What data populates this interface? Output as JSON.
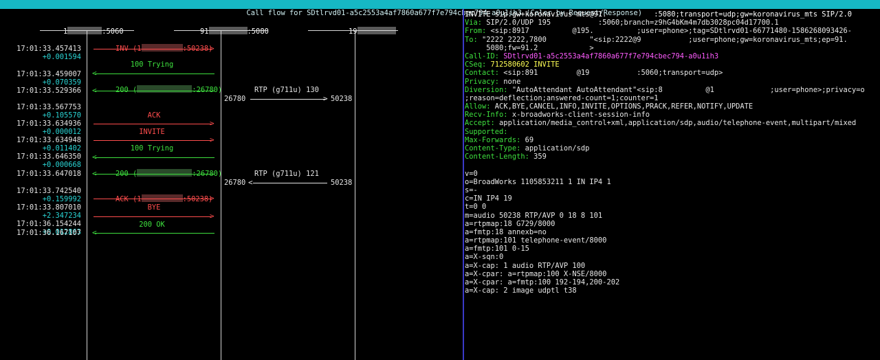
{
  "title": "Call flow for SDtlrvd01-a5c2553a4af7860a677f7e794cbec794-a0u1ih3 (Color by Request/Response)",
  "hosts": [
    {
      "label_left": "1",
      "label_right": ":5060"
    },
    {
      "label_left": "91",
      "label_right": ":5080"
    },
    {
      "label_left": "19",
      "label_right": ""
    }
  ],
  "flow": [
    {
      "ts": "17:01:33.457413",
      "delta": "+0.001594",
      "label_left": "INV (1",
      "label_right": ":50238)",
      "kind": "req",
      "dir": "right"
    },
    {
      "ts": "17:01:33.459007",
      "delta": "+0.070359",
      "label_left": "100 Trying",
      "label_right": "",
      "kind": "rsp",
      "dir": "left"
    },
    {
      "ts": "17:01:33.529366",
      "delta": "",
      "label_left": "200 (",
      "label_right": ":26780)",
      "kind": "rsp",
      "dir": "left"
    },
    {
      "ts": "17:01:33.567753",
      "delta": "+0.105570",
      "label_left": "ACK",
      "label_right": "",
      "kind": "req",
      "dir": "right"
    },
    {
      "ts": "17:01:33.634936",
      "delta": "+0.000012",
      "label_left": "INVITE",
      "label_right": "",
      "kind": "req",
      "dir": "right"
    },
    {
      "ts": "17:01:33.634948",
      "delta": "+0.011402",
      "label_left": "100 Trying",
      "label_right": "",
      "kind": "rsp",
      "dir": "left"
    },
    {
      "ts": "17:01:33.646350",
      "delta": "+0.000668",
      "label_left": "200 (",
      "label_right": ":26780)",
      "kind": "rsp",
      "dir": "left"
    },
    {
      "ts": "17:01:33.647018",
      "delta": "",
      "label_left": "",
      "label_right": "",
      "kind": "none",
      "dir": "none"
    },
    {
      "ts": "17:01:33.742540",
      "delta": "+0.159992",
      "label_left": "ACK (1",
      "label_right": ":50238)",
      "kind": "req",
      "dir": "right"
    },
    {
      "ts": "17:01:33.807010",
      "delta": "+2.347234",
      "label_left": "BYE",
      "label_right": "",
      "kind": "req",
      "dir": "right"
    },
    {
      "ts": "17:01:36.154244",
      "delta": "+0.012863",
      "label_left": "200 OK",
      "label_right": "",
      "kind": "rsp",
      "dir": "left"
    },
    {
      "ts": "17:01:36.167107",
      "delta": "",
      "label_left": "",
      "label_right": "",
      "kind": "none",
      "dir": "none"
    }
  ],
  "rtp": [
    {
      "label": "RTP (g711u) 130",
      "left_port": "26780",
      "right_port": "50238",
      "dir": "right"
    },
    {
      "label": "RTP (g711u) 121",
      "left_port": "26780",
      "right_port": "50238",
      "dir": "left"
    }
  ],
  "detail": {
    "first_line": "INVITE sip:gw+koronavirus mts@91.           :5080;transport=udp;gw=koronavirus_mts SIP/2.0",
    "headers": [
      {
        "k": "Via:",
        "v": " SIP/2.0/UDP 195           :5060;branch=z9hG4bKm4m7db3028pc04d17700.1",
        "c": "hv"
      },
      {
        "k": "From:",
        "v": " <sip:8917          @195.          ;user=phone>;tag=SDtlrvd01-66771480-1586268093426-",
        "c": "hv"
      },
      {
        "k": "To:",
        "v": " \"2222 2222,7800          \"<sip:2222@9           ;user=phone;gw=koronavirus_mts;ep=91.",
        "c": "hv"
      },
      {
        "k": "",
        "v": "     5080;fw=91.2            >",
        "c": "hv"
      },
      {
        "k": "Call-ID:",
        "v": " SDtlrvd01-a5c2553a4af7860a677f7e794cbec794-a0u1ih3",
        "c": "mag"
      },
      {
        "k": "CSeq:",
        "v": " 712580602 INVITE",
        "c": "yel"
      },
      {
        "k": "Contact:",
        "v": " <sip:891         @19           :5060;transport=udp>",
        "c": "hv"
      },
      {
        "k": "Privacy:",
        "v": " none",
        "c": "hv"
      },
      {
        "k": "Diversion:",
        "v": " \"AutoAttendant AutoAttendant\"<sip:8          @1             ;user=phone>;privacy=o",
        "c": "hv"
      },
      {
        "k": "",
        "v": ";reason=deflection;answered-count=1;counter=1",
        "c": "hv"
      },
      {
        "k": "Allow:",
        "v": " ACK,BYE,CANCEL,INFO,INVITE,OPTIONS,PRACK,REFER,NOTIFY,UPDATE",
        "c": "hv"
      },
      {
        "k": "Recv-Info:",
        "v": " x-broadworks-client-session-info",
        "c": "hv"
      },
      {
        "k": "Accept:",
        "v": " application/media_control+xml,application/sdp,audio/telephone-event,multipart/mixed",
        "c": "hv"
      },
      {
        "k": "Supported:",
        "v": "",
        "c": "hv"
      },
      {
        "k": "Max-Forwards:",
        "v": " 69",
        "c": "hv"
      },
      {
        "k": "Content-Type:",
        "v": " application/sdp",
        "c": "hv"
      },
      {
        "k": "Content-Length:",
        "v": " 359",
        "c": "hv"
      }
    ],
    "sdp": [
      "v=0",
      "o=BroadWorks 1105853211 1 IN IP4 1",
      "s=-",
      "c=IN IP4 19",
      "t=0 0",
      "m=audio 50238 RTP/AVP 0 18 8 101",
      "a=rtpmap:18 G729/8000",
      "a=fmtp:18 annexb=no",
      "a=rtpmap:101 telephone-event/8000",
      "a=fmtp:101 0-15",
      "a=X-sqn:0",
      "a=X-cap: 1 audio RTP/AVP 100",
      "a=X-cpar: a=rtpmap:100 X-NSE/8000",
      "a=X-cpar: a=fmtp:100 192-194,200-202",
      "a=X-cap: 2 image udptl t38"
    ]
  },
  "colors": {
    "request": "#ff4d4d",
    "response": "#3ee03e",
    "titlebar": "#16b8c4",
    "delta": "#2ad6d6",
    "separator": "#3a3ac8"
  }
}
